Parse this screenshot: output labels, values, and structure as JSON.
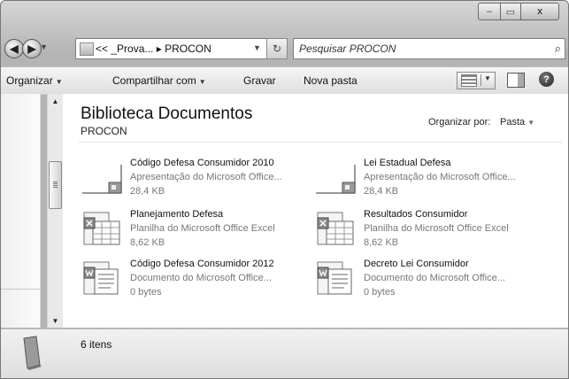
{
  "window": {
    "caption_buttons": {
      "minimize": "–",
      "maximize": "▭",
      "close": "x"
    }
  },
  "nav": {
    "back_glyph": "◀",
    "forward_glyph": "▶",
    "address": "<< _Prova... ▸ PROCON",
    "refresh_glyph": "↻",
    "search_placeholder": "Pesquisar PROCON"
  },
  "toolbar": {
    "organize": "Organizar",
    "share": "Compartilhar com",
    "burn": "Gravar",
    "new_folder": "Nova pasta",
    "help": "?"
  },
  "library": {
    "title": "Biblioteca Documentos",
    "subtitle": "PROCON",
    "arrange_label": "Organizar por:",
    "arrange_value": "Pasta"
  },
  "files": [
    {
      "name": "Código Defesa Consumidor 2010",
      "type": "Apresentação do Microsoft Office...",
      "size": "28,4 KB",
      "icon": "powerpoint-icon"
    },
    {
      "name": "Lei Estadual Defesa",
      "type": "Apresentação do Microsoft Office...",
      "size": "28,4 KB",
      "icon": "powerpoint-icon"
    },
    {
      "name": "Planejamento Defesa",
      "type": "Planilha do Microsoft Office Excel",
      "size": "8,62 KB",
      "icon": "excel-icon"
    },
    {
      "name": "Resultados Consumidor",
      "type": "Planilha do Microsoft Office Excel",
      "size": "8,62 KB",
      "icon": "excel-icon"
    },
    {
      "name": "Código Defesa Consumidor 2012",
      "type": "Documento  do Microsoft Office...",
      "size": "0 bytes",
      "icon": "word-icon"
    },
    {
      "name": "Decreto Lei Consumidor",
      "type": "Documento  do Microsoft Office...",
      "size": "0 bytes",
      "icon": "word-icon"
    }
  ],
  "status": {
    "count": "6 itens"
  }
}
